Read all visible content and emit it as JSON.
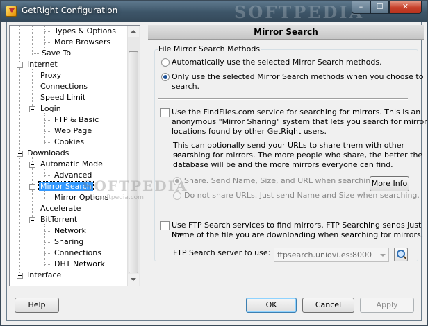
{
  "window": {
    "title": "GetRight Configuration",
    "watermark": "SOFTPEDIA",
    "controls": {
      "minimize": "–",
      "maximize": "☐",
      "close": "✕"
    }
  },
  "tree": {
    "items": [
      {
        "label": "Types & Options",
        "selected": false
      },
      {
        "label": "More Browsers",
        "selected": false
      },
      {
        "label": "Save To",
        "selected": false
      },
      {
        "label": "Internet",
        "selected": false
      },
      {
        "label": "Proxy",
        "selected": false
      },
      {
        "label": "Connections",
        "selected": false
      },
      {
        "label": "Speed Limit",
        "selected": false
      },
      {
        "label": "Login",
        "selected": false
      },
      {
        "label": "FTP & Basic",
        "selected": false
      },
      {
        "label": "Web Page",
        "selected": false
      },
      {
        "label": "Cookies",
        "selected": false
      },
      {
        "label": "Downloads",
        "selected": false
      },
      {
        "label": "Automatic Mode",
        "selected": false
      },
      {
        "label": "Advanced",
        "selected": false
      },
      {
        "label": "Mirror Search",
        "selected": true
      },
      {
        "label": "Mirror Options",
        "selected": false
      },
      {
        "label": "Accelerate",
        "selected": false
      },
      {
        "label": "BitTorrent",
        "selected": false
      },
      {
        "label": "Network",
        "selected": false
      },
      {
        "label": "Sharing",
        "selected": false
      },
      {
        "label": "Connections",
        "selected": false
      },
      {
        "label": "DHT Network",
        "selected": false
      },
      {
        "label": "Interface",
        "selected": false
      }
    ],
    "overlay_watermark": "SOFTPEDIA",
    "overlay_url": "www.softpedia.com"
  },
  "panel": {
    "header": "Mirror Search",
    "group_label": "File Mirror Search Methods",
    "radio_auto": {
      "label": "Automatically use the selected Mirror Search methods.",
      "checked": false
    },
    "radio_only": {
      "line1": "Only use the selected Mirror Search methods when you choose to",
      "line2": "search.",
      "checked": true
    },
    "findfiles": {
      "checked": false,
      "line1": "Use the FindFiles.com service for searching for mirrors.  This is an",
      "line2": "anonymous \"Mirror Sharing\" system that lets you search for mirror",
      "line3": "locations found by other GetRight users.",
      "share_line1": "This can optionally send your URLs to share them with other users",
      "share_line2": "searching for mirrors.  The more people who share, the better the",
      "share_line3": "database will be and the more mirrors everyone can find.",
      "radio_share": {
        "label": "Share.  Send Name, Size, and URL when searching.",
        "checked": true
      },
      "radio_noshare": {
        "label": "Do not share URLs.  Just send Name and Size when searching.",
        "checked": false
      },
      "more_info_label": "More Info"
    },
    "ftp": {
      "checked": false,
      "line1": "Use FTP Search services to find mirrors.  FTP Searching sends just the",
      "line2": "Name of the file you are downloading when searching for mirrors.",
      "server_label": "FTP Search server to use:",
      "server_value": "ftpsearch.uniovi.es:8000"
    }
  },
  "footer": {
    "help_label": "Help",
    "ok_label": "OK",
    "cancel_label": "Cancel",
    "apply_label": "Apply"
  }
}
